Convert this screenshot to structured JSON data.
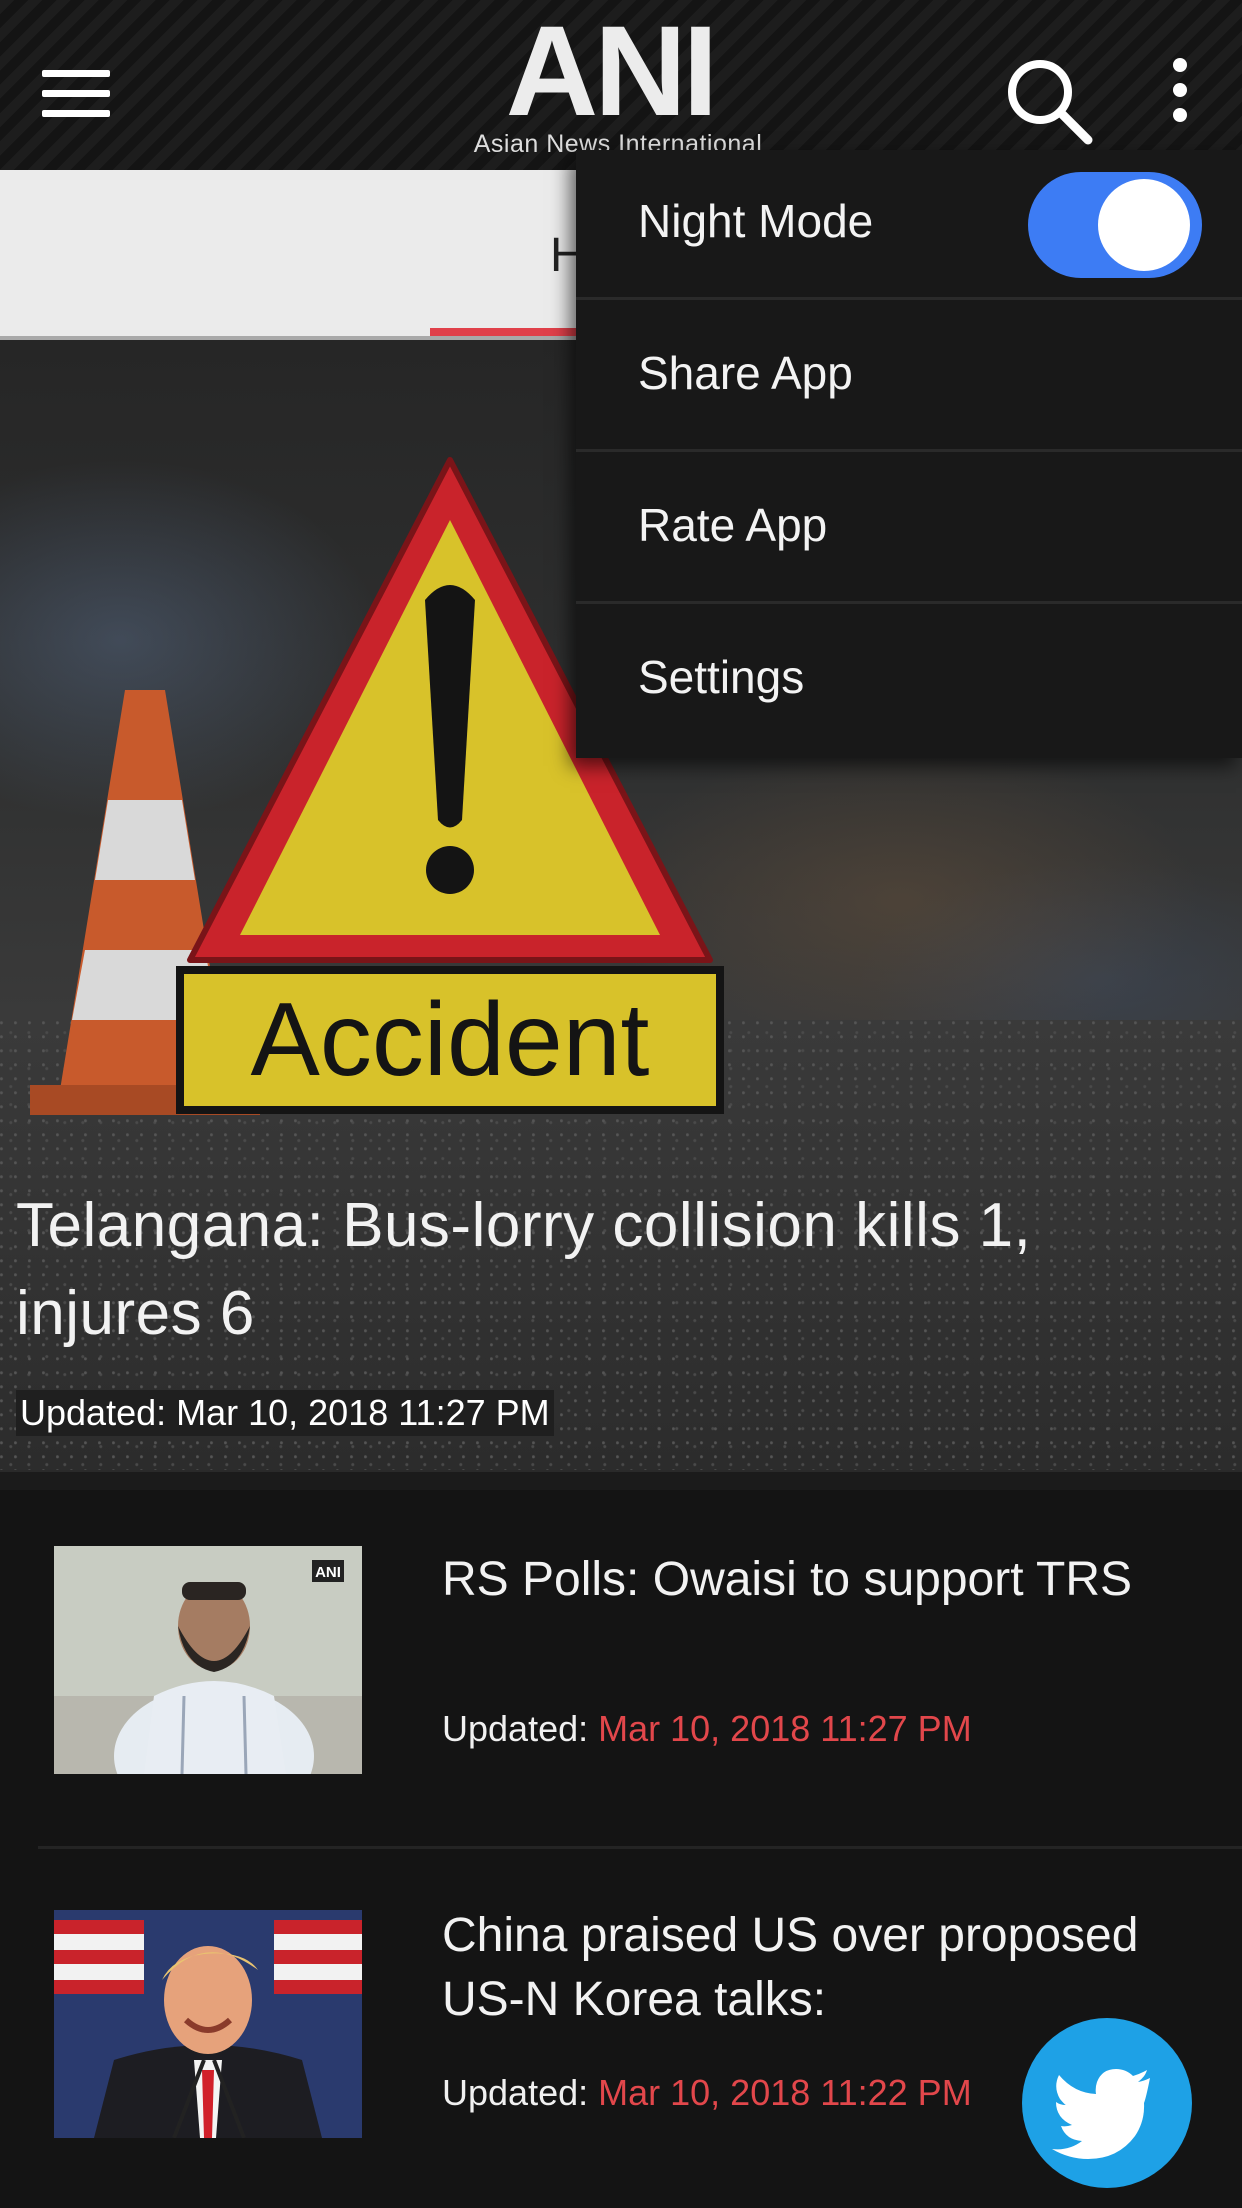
{
  "header": {
    "logo_text": "ANI",
    "logo_subtitle": "Asian News International",
    "menu_icon": "hamburger-icon",
    "search_icon": "search-icon",
    "more_icon": "more-vert-icon"
  },
  "tabs": {
    "active_label_partial": "H",
    "indicator_color": "#e0404a"
  },
  "hero": {
    "title": "Telangana: Bus-lorry collision kills 1, injures 6",
    "updated": "Updated: Mar 10, 2018 11:27 PM",
    "sign_text": "Accident"
  },
  "articles": [
    {
      "headline": "RS Polls: Owaisi to support TRS",
      "updated_label": "Updated: ",
      "updated_date": "Mar 10, 2018 11:27 PM",
      "thumb_badge": "ANI"
    },
    {
      "headline": "China praised US over proposed US-N Korea talks:",
      "updated_label": "Updated: ",
      "updated_date": "Mar 10, 2018 11:22 PM"
    }
  ],
  "overflow_menu": {
    "night_mode_label": "Night Mode",
    "night_mode_on": true,
    "share_label": "Share App",
    "rate_label": "Rate App",
    "settings_label": "Settings"
  },
  "fab": {
    "icon": "twitter-icon",
    "color": "#1ea1e6"
  },
  "colors": {
    "accent_red": "#e2474b",
    "toggle_blue": "#3d7cf4"
  }
}
